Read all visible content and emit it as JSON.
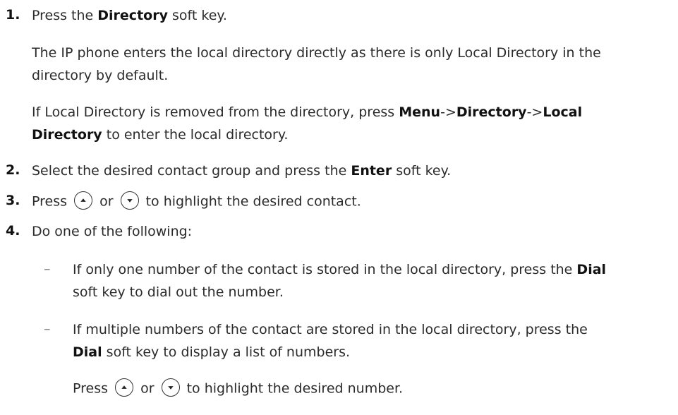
{
  "steps": [
    {
      "number": "1.",
      "pre": "Press the ",
      "bold": "Directory",
      "post": " soft key.",
      "paragraphs": [
        {
          "line1": "The IP phone enters the local directory directly as there is only Local Directory in the",
          "line2": "directory by default."
        },
        {
          "line1_pre": "If Local Directory is removed from the directory, press ",
          "menu": "Menu",
          "arrow1": "->",
          "directory": "Directory",
          "arrow2": "->",
          "local": "Local",
          "line2_bold": "Directory",
          "line2_post": " to enter the local directory."
        }
      ]
    },
    {
      "number": "2.",
      "pre": "Select the desired contact group and press the ",
      "bold": "Enter",
      "post": " soft key."
    },
    {
      "number": "3.",
      "pre": "Press ",
      "or": " or ",
      "post": " to highlight the desired contact."
    },
    {
      "number": "4.",
      "text": "Do one of the following:",
      "bullets": [
        {
          "dash": "–",
          "line1_pre": "If only one number of the contact is stored in the local directory, press the ",
          "line1_bold": "Dial",
          "line2": "soft key to dial out the number."
        },
        {
          "dash": "–",
          "line1": "If multiple numbers of the contact are stored in the local directory, press the",
          "line2_bold": "Dial",
          "line2_post": " soft key to display a list of numbers.",
          "line3_pre": "Press ",
          "line3_or": " or ",
          "line3_post": " to highlight the desired number."
        }
      ]
    }
  ],
  "icons": {
    "up": "up-arrow-key-icon",
    "down": "down-arrow-key-icon"
  }
}
